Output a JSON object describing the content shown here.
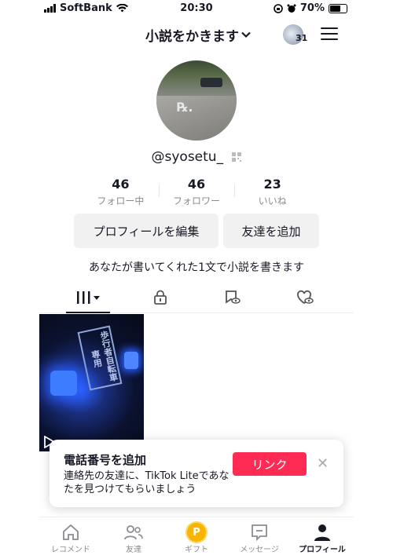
{
  "status_bar": {
    "carrier": "SoftBank",
    "time": "20:30",
    "battery": "70%",
    "battery_level": 0.7
  },
  "header": {
    "account_name": "小説をかきます",
    "visitor_count": "31"
  },
  "profile": {
    "handle": "@syosetu_",
    "stats": [
      {
        "value": "46",
        "label": "フォロー中"
      },
      {
        "value": "46",
        "label": "フォロワー"
      },
      {
        "value": "23",
        "label": "いいね"
      }
    ],
    "edit_button": "プロフィールを編集",
    "add_friend_button": "友達を追加",
    "bio": "あなたが書いてくれた1文で小説を書きます"
  },
  "tabs": [
    {
      "icon": "grid-icon",
      "active": true
    },
    {
      "icon": "lock-icon",
      "active": false
    },
    {
      "icon": "bookmark-eye-icon",
      "active": false
    },
    {
      "icon": "heart-eye-icon",
      "active": false
    }
  ],
  "video": {
    "sign_text": "歩行者自転車専用"
  },
  "toast": {
    "title": "電話番号を追加",
    "body": "連絡先の友達に、TikTok Liteであなたを見つけてもらいましょう",
    "link_button": "リンク",
    "accent_color": "#fe2c55"
  },
  "bottom_nav": [
    {
      "label": "レコメンド",
      "icon": "home-icon"
    },
    {
      "label": "友達",
      "icon": "friends-icon"
    },
    {
      "label": "ギフト",
      "icon": "gift-coin-icon"
    },
    {
      "label": "メッセージ",
      "icon": "message-icon"
    },
    {
      "label": "プロフィール",
      "icon": "profile-icon",
      "active": true
    }
  ]
}
